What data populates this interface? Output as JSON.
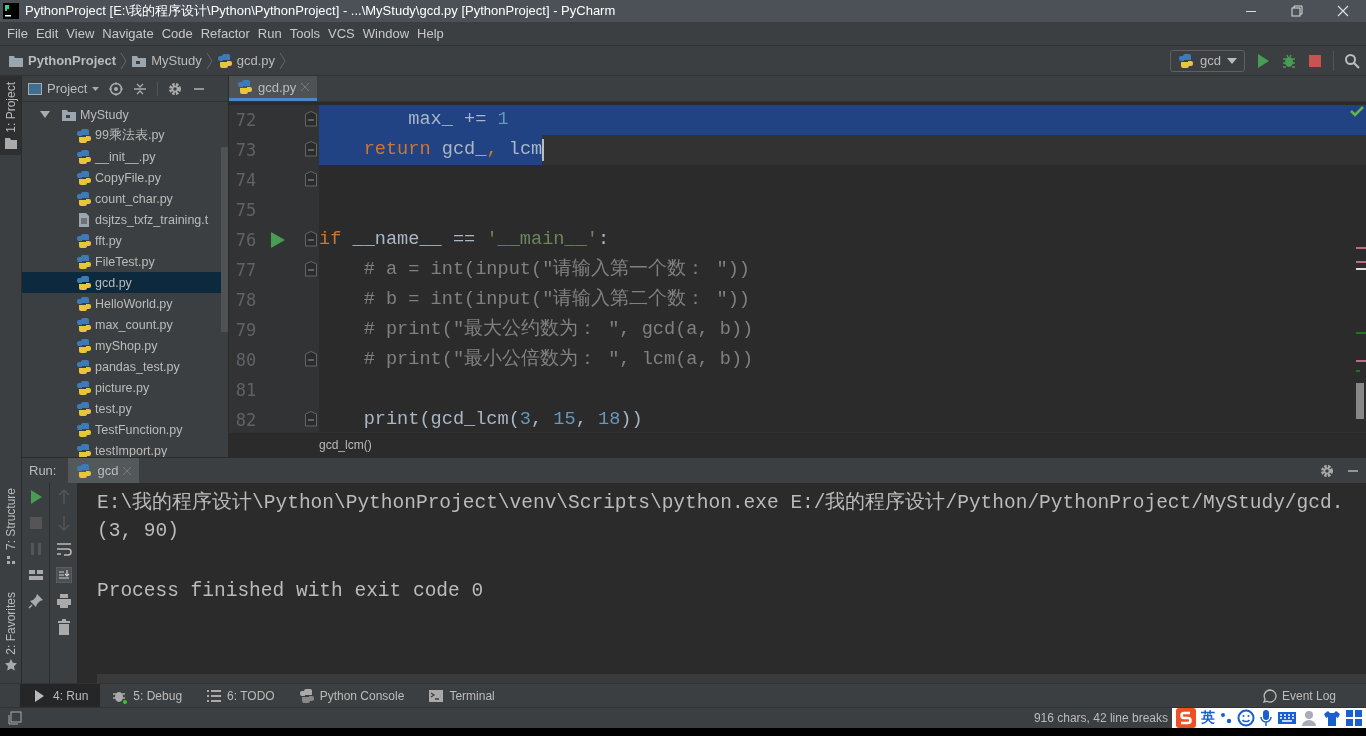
{
  "window": {
    "title": "PythonProject [E:\\我的程序设计\\Python\\PythonProject] - ...\\MyStudy\\gcd.py [PythonProject] - PyCharm"
  },
  "menu": [
    "File",
    "Edit",
    "View",
    "Navigate",
    "Code",
    "Refactor",
    "Run",
    "Tools",
    "VCS",
    "Window",
    "Help"
  ],
  "breadcrumbs": [
    {
      "label": "PythonProject",
      "kind": "project"
    },
    {
      "label": "MyStudy",
      "kind": "folder"
    },
    {
      "label": "gcd.py",
      "kind": "file"
    }
  ],
  "run_config": {
    "label": "gcd"
  },
  "side_tabs_top": [
    {
      "label": "1: Project",
      "selected": true
    }
  ],
  "side_tabs_bottom": [
    {
      "label": "7: Structure",
      "selected": false
    },
    {
      "label": "2: Favorites",
      "selected": false
    }
  ],
  "project_panel": {
    "title": "Project",
    "tree": [
      {
        "label": "MyStudy",
        "kind": "folder",
        "expanded": true,
        "selected": false,
        "children": [
          {
            "label": "99乘法表.py",
            "kind": "py",
            "selected": false
          },
          {
            "label": "__init__.py",
            "kind": "py",
            "selected": false
          },
          {
            "label": "CopyFile.py",
            "kind": "py",
            "selected": false
          },
          {
            "label": "count_char.py",
            "kind": "py",
            "selected": false
          },
          {
            "label": "dsjtzs_txfz_training.t",
            "kind": "text",
            "selected": false
          },
          {
            "label": "fft.py",
            "kind": "py",
            "selected": false
          },
          {
            "label": "FileTest.py",
            "kind": "py",
            "selected": false
          },
          {
            "label": "gcd.py",
            "kind": "py",
            "selected": true
          },
          {
            "label": "HelloWorld.py",
            "kind": "py",
            "selected": false
          },
          {
            "label": "max_count.py",
            "kind": "py",
            "selected": false
          },
          {
            "label": "myShop.py",
            "kind": "py",
            "selected": false
          },
          {
            "label": "pandas_test.py",
            "kind": "py",
            "selected": false
          },
          {
            "label": "picture.py",
            "kind": "py",
            "selected": false
          },
          {
            "label": "test.py",
            "kind": "py",
            "selected": false
          },
          {
            "label": "TestFunction.py",
            "kind": "py",
            "selected": false
          },
          {
            "label": "testImport.py",
            "kind": "py",
            "selected": false
          }
        ]
      }
    ]
  },
  "editor": {
    "tabs": [
      {
        "label": "gcd.py",
        "selected": true
      }
    ],
    "lines": [
      {
        "number": "72",
        "fold": true,
        "run_marker": false,
        "selected": true,
        "caret": false,
        "tokens": [
          {
            "kind": "plain",
            "text": "        max_ += "
          },
          {
            "kind": "number",
            "text": "1"
          }
        ]
      },
      {
        "number": "73",
        "fold": true,
        "run_marker": false,
        "selected": true,
        "caret": true,
        "tokens": [
          {
            "kind": "keyword",
            "text": "    return"
          },
          {
            "kind": "plain",
            "text": " gcd_"
          },
          {
            "kind": "keyword",
            "text": ","
          },
          {
            "kind": "plain",
            "text": " lcm"
          }
        ]
      },
      {
        "number": "74",
        "fold": true,
        "run_marker": false,
        "selected": false,
        "caret": false
      },
      {
        "number": "75",
        "fold": false,
        "run_marker": false,
        "selected": false,
        "caret": false
      },
      {
        "number": "76",
        "fold": true,
        "run_marker": true,
        "selected": false,
        "caret": false,
        "tokens": [
          {
            "kind": "keyword",
            "text": "if"
          },
          {
            "kind": "plain",
            "text": " __name__ == "
          },
          {
            "kind": "string",
            "text": "'__main__'"
          },
          {
            "kind": "plain",
            "text": ":"
          }
        ]
      },
      {
        "number": "77",
        "fold": true,
        "run_marker": false,
        "selected": false,
        "caret": false,
        "tokens": [
          {
            "kind": "comment",
            "text": "    # a = int(input(\"请输入第一个数： \"))"
          }
        ]
      },
      {
        "number": "78",
        "fold": false,
        "run_marker": false,
        "selected": false,
        "caret": false,
        "tokens": [
          {
            "kind": "comment",
            "text": "    # b = int(input(\"请输入第二个数： \"))"
          }
        ]
      },
      {
        "number": "79",
        "fold": false,
        "run_marker": false,
        "selected": false,
        "caret": false,
        "tokens": [
          {
            "kind": "comment",
            "text": "    # print(\"最大公约数为： \", gcd(a, b))"
          }
        ]
      },
      {
        "number": "80",
        "fold": true,
        "run_marker": false,
        "selected": false,
        "caret": false,
        "tokens": [
          {
            "kind": "comment",
            "text": "    # print(\"最小公倍数为： \", lcm(a, b))"
          }
        ]
      },
      {
        "number": "81",
        "fold": false,
        "run_marker": false,
        "selected": false,
        "caret": false
      },
      {
        "number": "82",
        "fold": true,
        "run_marker": false,
        "selected": false,
        "caret": false,
        "tokens": [
          {
            "kind": "plain",
            "text": "    print(gcd_lcm("
          },
          {
            "kind": "number",
            "text": "3"
          },
          {
            "kind": "plain",
            "text": ", "
          },
          {
            "kind": "number",
            "text": "15"
          },
          {
            "kind": "plain",
            "text": ", "
          },
          {
            "kind": "number",
            "text": "18"
          },
          {
            "kind": "plain",
            "text": "))"
          }
        ]
      }
    ],
    "breadcrumb": "gcd_lcm()"
  },
  "run_panel": {
    "label": "Run:",
    "tabs": [
      {
        "label": "gcd",
        "selected": true
      }
    ],
    "output": [
      {
        "kind": "command",
        "text": "E:\\我的程序设计\\Python\\PythonProject\\venv\\Scripts\\python.exe E:/我的程序设计/Python/PythonProject/MyStudy/gcd."
      },
      {
        "kind": "result",
        "text": "(3, 90)"
      },
      {
        "kind": "exit",
        "text": "Process finished with exit code 0"
      }
    ]
  },
  "bottom_tabs": [
    {
      "label": "4: Run",
      "kind": "run",
      "selected": true
    },
    {
      "label": "5: Debug",
      "kind": "debug",
      "selected": false
    },
    {
      "label": "6: TODO",
      "kind": "todo",
      "selected": false
    },
    {
      "label": "Python Console",
      "kind": "console",
      "selected": false
    },
    {
      "label": "Terminal",
      "kind": "terminal",
      "selected": false
    }
  ],
  "event_log": "Event Log",
  "status_bar": {
    "text": "916 chars, 42 line breaks",
    "ime_mode": "英"
  }
}
